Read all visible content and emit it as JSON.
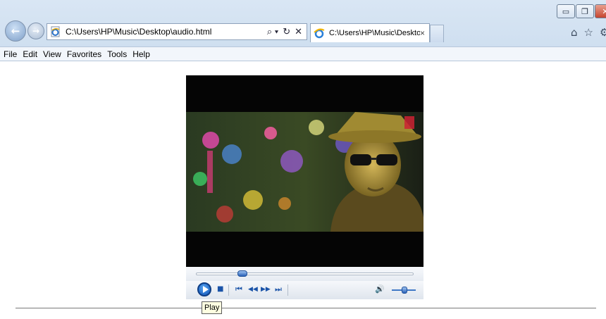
{
  "browser": {
    "address_url": "C:\\Users\\HP\\Music\\Desktop\\audio.html",
    "tab_title": "C:\\Users\\HP\\Music\\Desktop...",
    "tab_close_glyph": "×",
    "window_controls": {
      "minimize": "▭",
      "maximize": "❐",
      "close": "✕"
    },
    "nav": {
      "back": "←",
      "forward": "→"
    },
    "addr_tools": {
      "search": "⌕ ▾",
      "refresh": "↻",
      "stop": "✕"
    },
    "right_tools": {
      "home": "⌂",
      "favorites": "☆",
      "settings": "⚙"
    }
  },
  "menu": {
    "items": [
      "File",
      "Edit",
      "View",
      "Favorites",
      "Tools",
      "Help"
    ]
  },
  "player": {
    "seek_position": 0.2,
    "volume_level": 0.55,
    "tooltip": "Play",
    "icons": {
      "stop": "■",
      "prev": "⏮",
      "rewind": "◀◀",
      "fastforward": "▶▶",
      "next": "⏭",
      "volume": "🔊"
    }
  },
  "colors": {
    "chrome": "#d9e6f4",
    "accent": "#1a53a8",
    "close": "#c6452f"
  }
}
